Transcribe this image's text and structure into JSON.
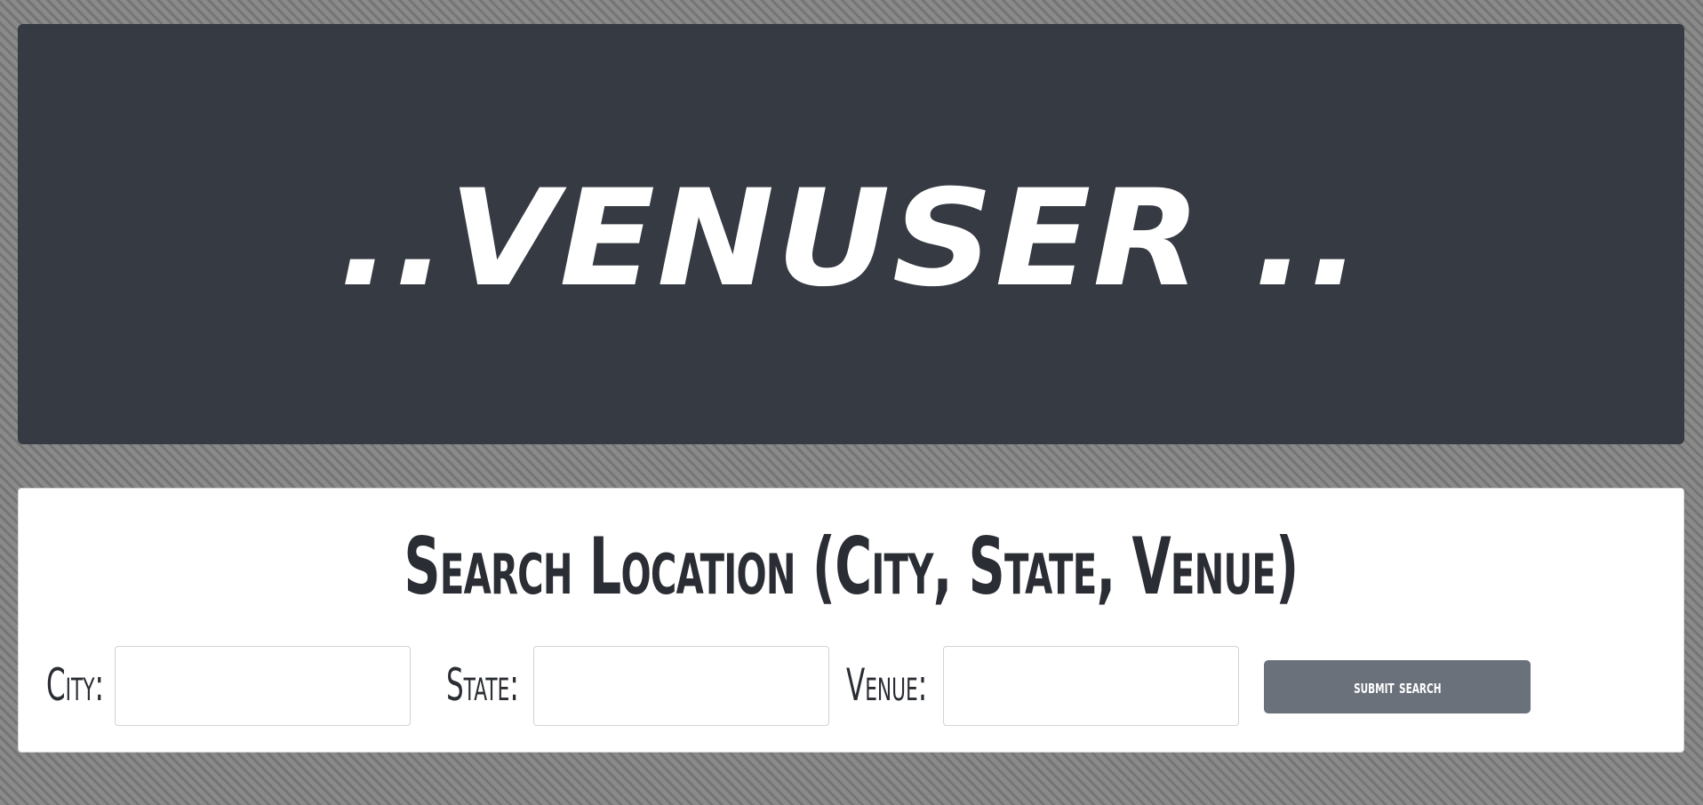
{
  "header": {
    "title": "..VENUSER .."
  },
  "search": {
    "heading": "Search Location (City, State, Venue)",
    "city_label": "City:",
    "city_value": "",
    "state_label": "State:",
    "state_value": "",
    "venue_label": "Venue:",
    "venue_value": "",
    "submit_label": "submit search"
  },
  "colors": {
    "hero_background": "#363a42",
    "page_background": "#838383",
    "button_background": "#6b717b",
    "text_dark": "#2a2d33"
  }
}
